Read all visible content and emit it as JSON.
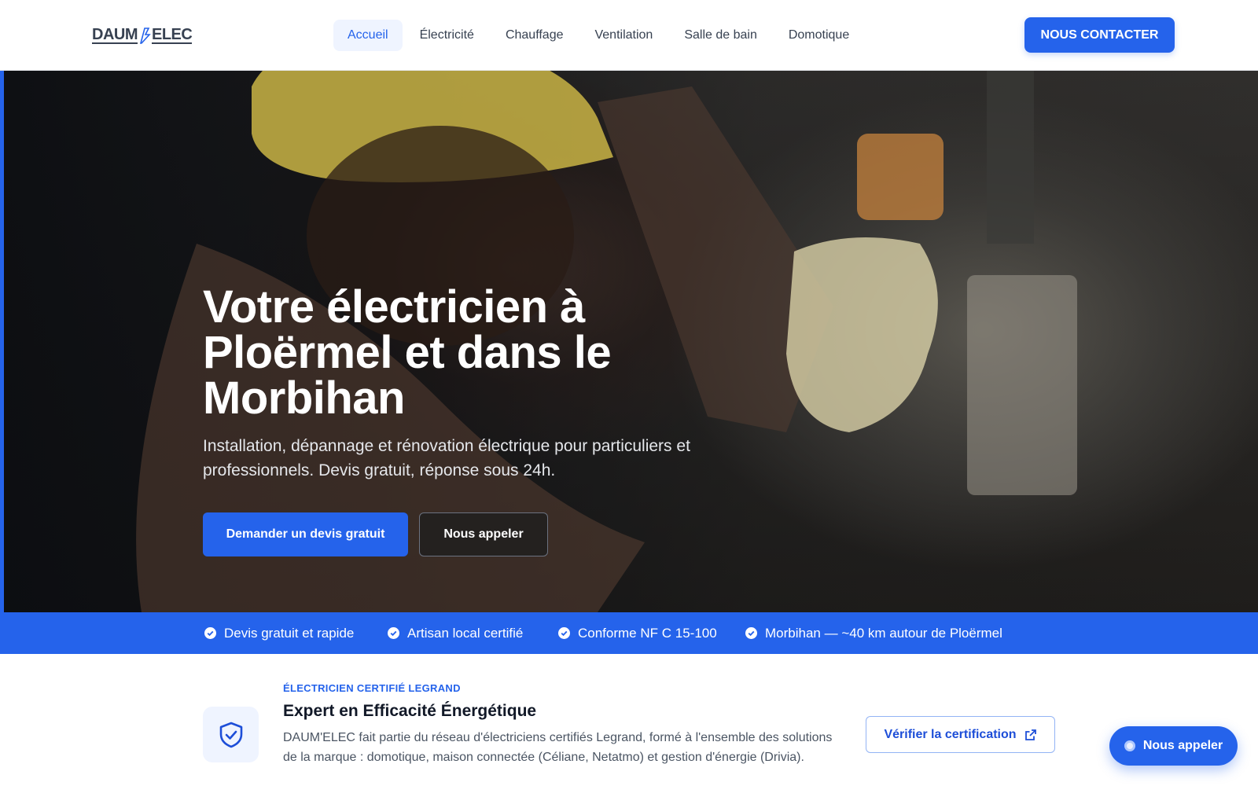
{
  "header": {
    "logo_left": "DAUM",
    "logo_right": "ELEC",
    "nav": [
      {
        "label": "Accueil",
        "active": true
      },
      {
        "label": "Électricité",
        "active": false
      },
      {
        "label": "Chauffage",
        "active": false
      },
      {
        "label": "Ventilation",
        "active": false
      },
      {
        "label": "Salle de bain",
        "active": false
      },
      {
        "label": "Domotique",
        "active": false
      }
    ],
    "cta_label": "NOUS CONTACTER"
  },
  "hero": {
    "title": "Votre électricien à Ploërmel et dans le Morbihan",
    "subtitle": "Installation, dépannage et rénovation électrique pour particuliers et professionnels. Devis gratuit, réponse sous 24h.",
    "primary_button": "Demander un devis gratuit",
    "secondary_button": "Nous appeler"
  },
  "trust_bar": {
    "items": [
      "Devis gratuit et rapide",
      "Artisan local certifié",
      "Conforme NF C 15-100",
      "Morbihan — ~40 km autour de Ploërmel"
    ]
  },
  "certification": {
    "eyebrow": "ÉLECTRICIEN CERTIFIÉ LEGRAND",
    "title": "Expert en Efficacité Énergétique",
    "description": "DAUM'ELEC fait partie du réseau d'électriciens certifiés Legrand, formé à l'ensemble des solutions de la marque : domotique, maison connectée (Céliane, Netatmo) et gestion d'énergie (Drivia).",
    "verify_button": "Vérifier la certification"
  },
  "floating_call": {
    "label": "Nous appeler"
  },
  "colors": {
    "accent": "#2563eb",
    "nav_active_bg": "#eff4ff",
    "text_dark": "#111827"
  }
}
